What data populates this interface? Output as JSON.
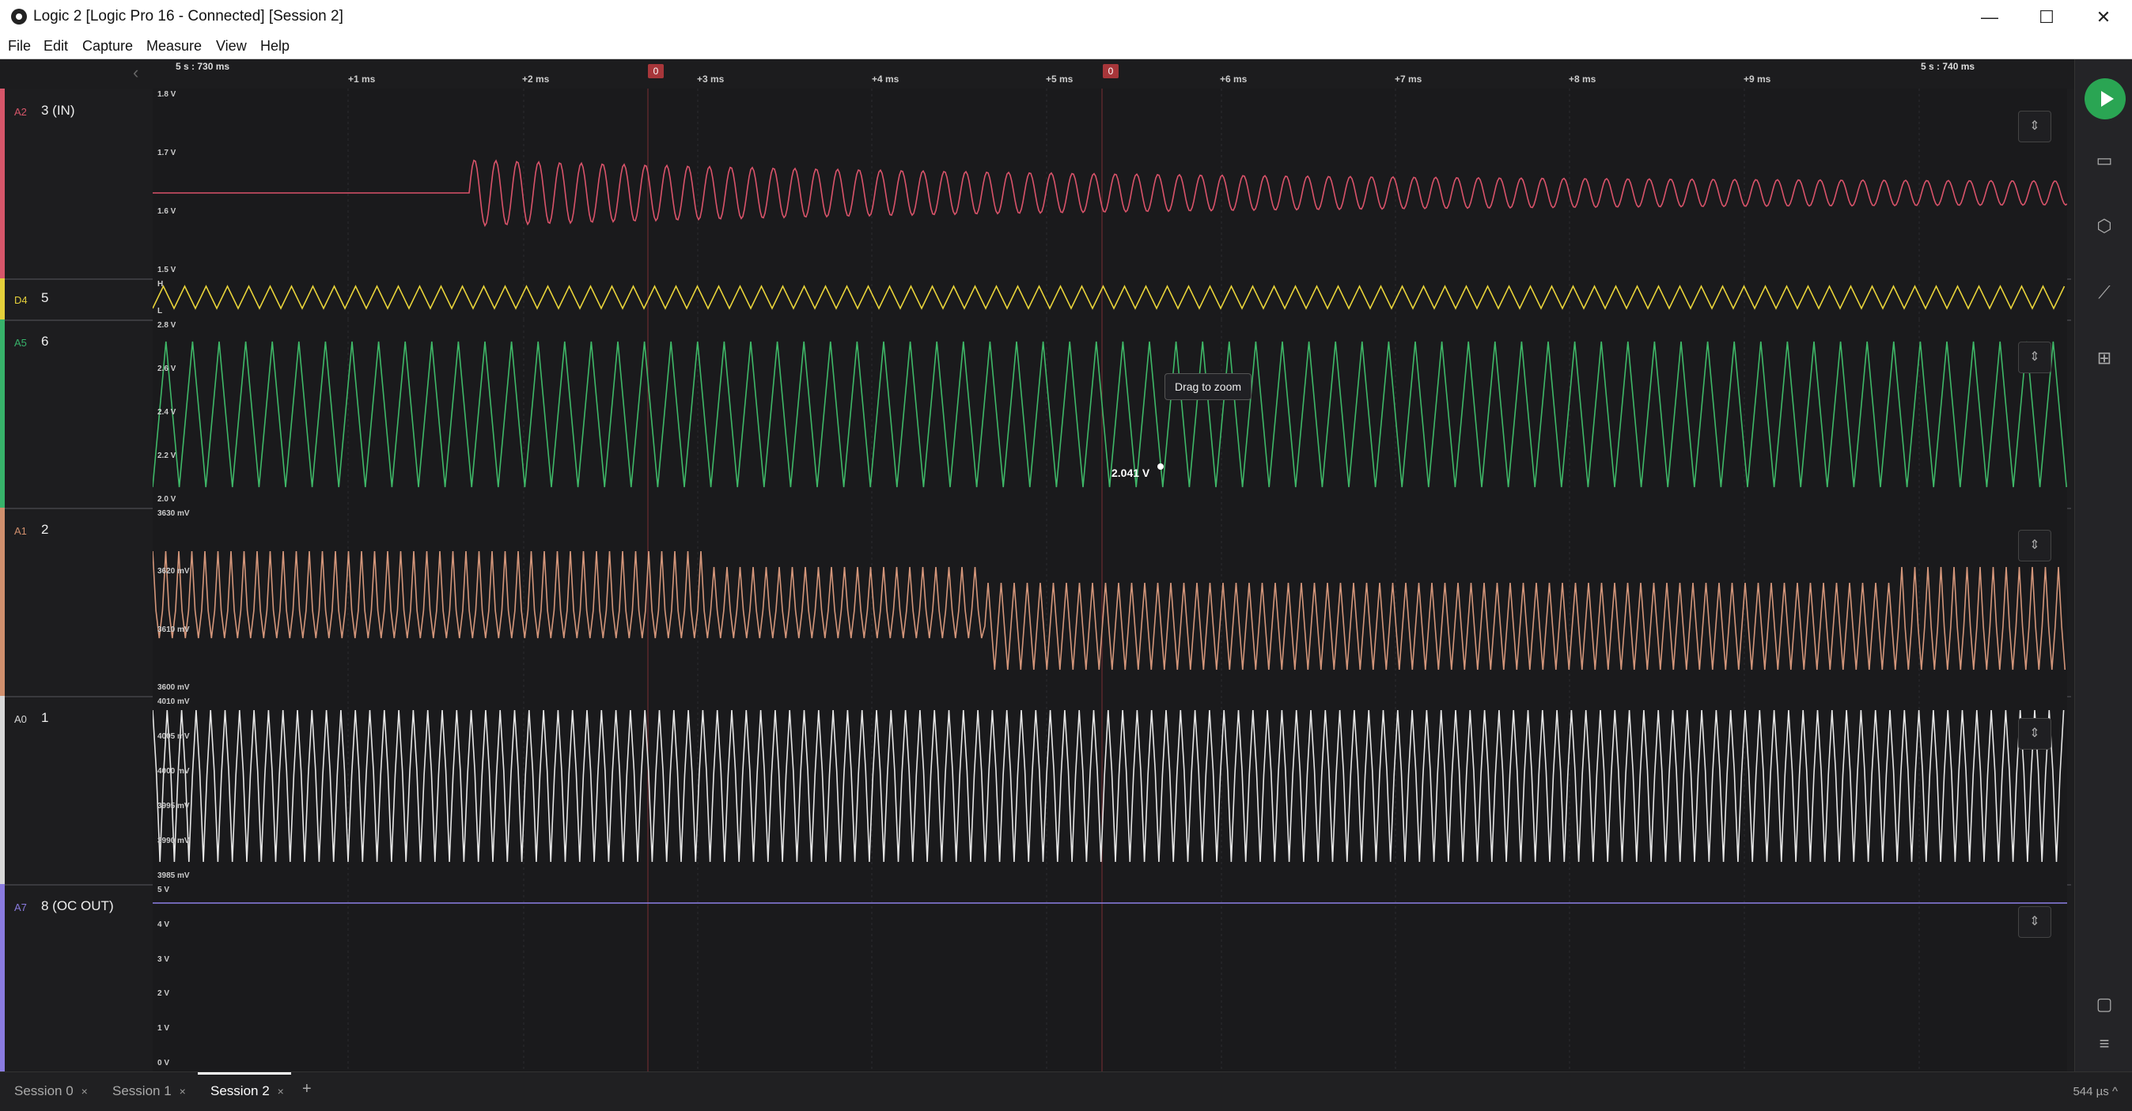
{
  "window": {
    "title": "Logic 2 [Logic Pro 16 - Connected] [Session 2]",
    "minimize": "—",
    "maximize": "☐",
    "close": "✕"
  },
  "menu": [
    "File",
    "Edit",
    "Capture",
    "Measure",
    "View",
    "Help"
  ],
  "timeline": {
    "start_abs": "5 s : 730 ms",
    "end_abs": "5 s : 740 ms",
    "ticks": [
      "+1 ms",
      "+2 ms",
      "+3 ms",
      "+4 ms",
      "+5 ms",
      "+6 ms",
      "+7 ms",
      "+8 ms",
      "+9 ms"
    ],
    "markers": [
      "0",
      "0"
    ]
  },
  "channels": [
    {
      "id": "A2",
      "name": "3 (IN)",
      "color": "#d6566a",
      "trace_color": "#d9536a",
      "ylabels": [
        "1.8 V",
        "1.7 V",
        "1.6 V",
        "1.5 V"
      ]
    },
    {
      "id": "D4",
      "name": "5",
      "color": "#e4cf3a",
      "trace_color": "#e8d33a",
      "ylabels": [
        "H",
        "L"
      ]
    },
    {
      "id": "A5",
      "name": "6",
      "color": "#37b36a",
      "trace_color": "#3fb868",
      "ylabels": [
        "2.8 V",
        "2.6 V",
        "2.4 V",
        "2.2 V",
        "2.0 V"
      ]
    },
    {
      "id": "A1",
      "name": "2",
      "color": "#d08f6d",
      "trace_color": "#d4967a",
      "ylabels": [
        "3630 mV",
        "3620 mV",
        "3610 mV",
        "3600 mV"
      ]
    },
    {
      "id": "A0",
      "name": "1",
      "color": "#d8d8d8",
      "trace_color": "#e6e6e6",
      "ylabels": [
        "4010 mV",
        "4005 mV",
        "4000 mV",
        "3995 mV",
        "3990 mV",
        "3985 mV"
      ]
    },
    {
      "id": "A7",
      "name": "8 (OC OUT)",
      "color": "#8a7be0",
      "trace_color": "#8c7fe6",
      "ylabels": [
        "5 V",
        "4 V",
        "3 V",
        "2 V",
        "1 V",
        "0 V"
      ]
    }
  ],
  "tooltip": "Drag to zoom",
  "cursor_value": "2.041 V",
  "tabs": [
    {
      "label": "Session 0",
      "close": "×"
    },
    {
      "label": "Session 1",
      "close": "×"
    },
    {
      "label": "Session 2",
      "close": "×"
    }
  ],
  "add_tab": "+",
  "zoom_status": "544 µs ^",
  "sidebar_icons": [
    "play-icon",
    "analyzers-icon",
    "triggers-icon",
    "measure-icon",
    "extensions-icon",
    "notes-icon",
    "menu-icon"
  ]
}
